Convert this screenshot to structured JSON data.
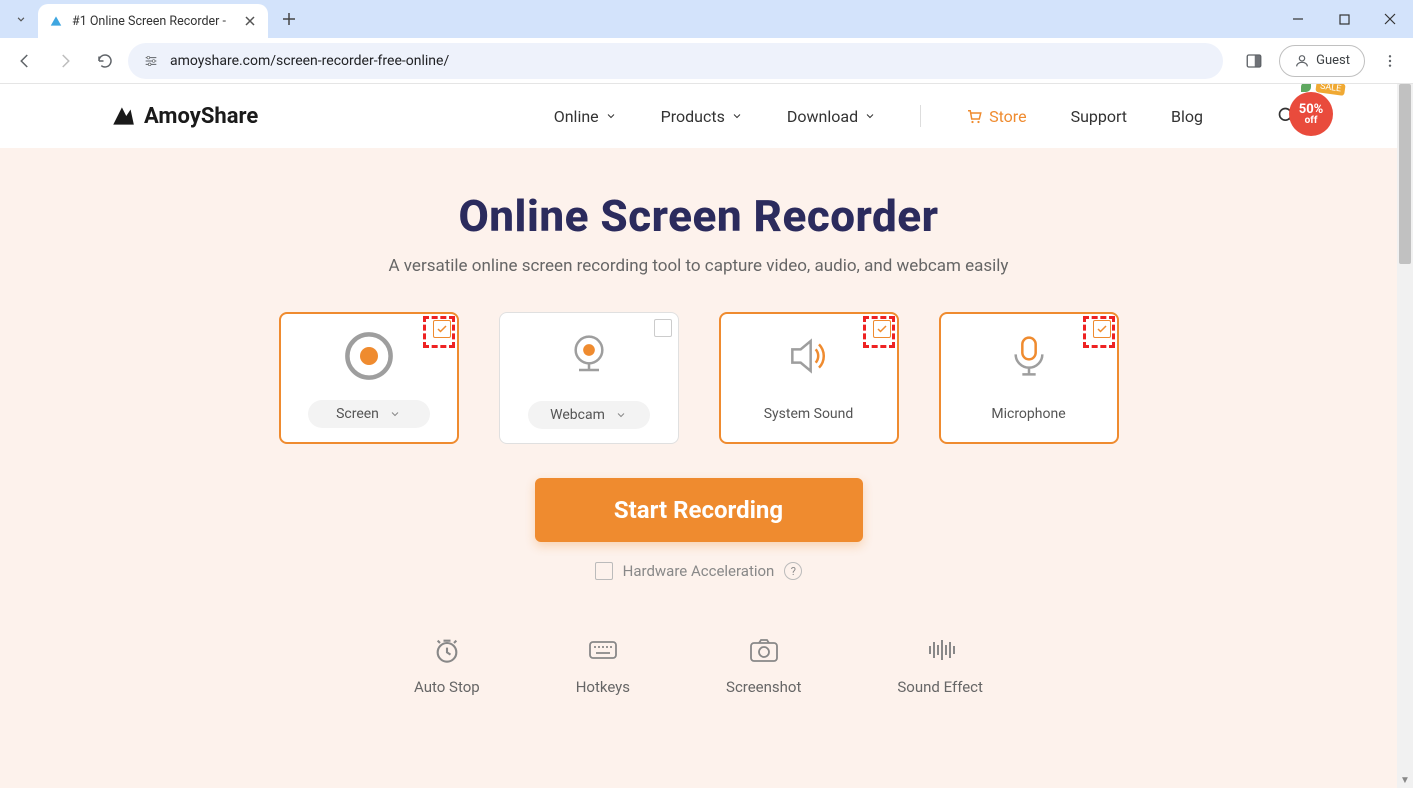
{
  "browser": {
    "tab_title": "#1 Online Screen Recorder -",
    "url": "amoyshare.com/screen-recorder-free-online/",
    "guest_label": "Guest"
  },
  "header": {
    "logo_text": "AmoyShare",
    "nav": {
      "online": "Online",
      "products": "Products",
      "download": "Download",
      "store": "Store",
      "support": "Support",
      "blog": "Blog"
    },
    "sale": {
      "tag": "SALE",
      "line1": "50%",
      "line2": "off"
    }
  },
  "hero": {
    "title": "Online Screen Recorder",
    "subtitle": "A versatile online screen recording tool to capture video, audio, and webcam easily",
    "cards": {
      "screen": "Screen",
      "webcam": "Webcam",
      "system_sound": "System Sound",
      "microphone": "Microphone"
    },
    "start_button": "Start Recording",
    "hw_accel": "Hardware Acceleration"
  },
  "features": {
    "auto_stop": "Auto Stop",
    "hotkeys": "Hotkeys",
    "screenshot": "Screenshot",
    "sound_effect": "Sound Effect"
  }
}
